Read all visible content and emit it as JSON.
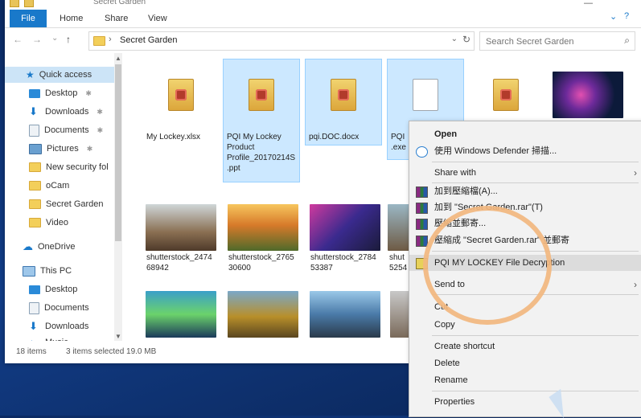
{
  "window": {
    "title": "Secret Garden",
    "minimize": "—",
    "help": "?"
  },
  "ribbon": {
    "tabs": [
      "File",
      "Home",
      "Share",
      "View"
    ],
    "expand": "⌄"
  },
  "address": {
    "back": "←",
    "forward": "→",
    "recent": "⌄",
    "up": "↑",
    "chevron": "›",
    "path": "Secret Garden",
    "dropdown": "⌄",
    "refresh": "↻"
  },
  "search": {
    "placeholder": "Search Secret Garden",
    "icon": "search-icon"
  },
  "sidebar": {
    "quick_access": "Quick access",
    "items": [
      {
        "label": "Desktop",
        "icon": "desktop-icon",
        "pinned": true
      },
      {
        "label": "Downloads",
        "icon": "downloads-icon",
        "pinned": true
      },
      {
        "label": "Documents",
        "icon": "documents-icon",
        "pinned": true
      },
      {
        "label": "Pictures",
        "icon": "pictures-icon",
        "pinned": true
      },
      {
        "label": "New security fol",
        "icon": "folder-icon",
        "pinned": false
      },
      {
        "label": "oCam",
        "icon": "folder-icon",
        "pinned": false
      },
      {
        "label": "Secret Garden",
        "icon": "folder-icon",
        "pinned": false
      },
      {
        "label": "Video",
        "icon": "folder-icon",
        "pinned": false
      }
    ],
    "onedrive": "OneDrive",
    "thispc": "This PC",
    "pc_items": [
      {
        "label": "Desktop",
        "icon": "desktop-icon"
      },
      {
        "label": "Documents",
        "icon": "documents-icon"
      },
      {
        "label": "Downloads",
        "icon": "downloads-icon"
      },
      {
        "label": "Music",
        "icon": "music-icon"
      }
    ],
    "pin_glyph": "📌"
  },
  "files": [
    {
      "name": "My Lockey.xlsx",
      "type": "locked",
      "selected": false
    },
    {
      "name": "PQI My Lockey Product Profile_20170214S.ppt",
      "type": "locked",
      "selected": true
    },
    {
      "name": "pqi.DOC.docx",
      "type": "locked",
      "selected": true
    },
    {
      "name": "PQI\n.exe",
      "type": "plain",
      "selected": true
    },
    {
      "name": "",
      "type": "locked",
      "selected": false
    },
    {
      "name": "",
      "type": "photo",
      "selected": false
    }
  ],
  "images_row1": [
    {
      "name": "shutterstock_247468942"
    },
    {
      "name": "shutterstock_276530600"
    },
    {
      "name": "shutterstock_278453387"
    },
    {
      "name": "shut\n5254"
    }
  ],
  "status": {
    "count": "18 items",
    "selected": "3 items selected  19.0 MB"
  },
  "context_menu": {
    "open": "Open",
    "defender": "使用 Windows Defender 掃描...",
    "share_with": "Share with",
    "add_archive": "加到壓縮檔(A)...",
    "add_rar": "加到 \"Secret Garden.rar\"(T)",
    "compress_email": "壓縮並郵寄...",
    "compress_rar_email": "壓縮成 \"Secret Garden.rar\" 並郵寄",
    "pqi_decrypt": "PQI MY LOCKEY File Decryption",
    "send_to": "Send to",
    "cut": "Cut",
    "copy": "Copy",
    "create_shortcut": "Create shortcut",
    "delete": "Delete",
    "rename": "Rename",
    "properties": "Properties",
    "arrow": "›"
  }
}
